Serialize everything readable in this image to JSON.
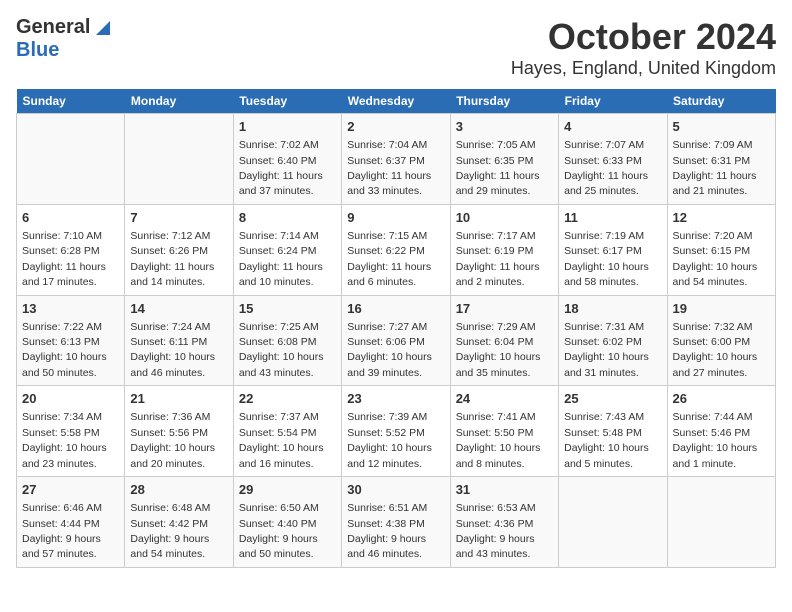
{
  "logo": {
    "line1": "General",
    "line2": "Blue"
  },
  "title": "October 2024",
  "subtitle": "Hayes, England, United Kingdom",
  "days_of_week": [
    "Sunday",
    "Monday",
    "Tuesday",
    "Wednesday",
    "Thursday",
    "Friday",
    "Saturday"
  ],
  "weeks": [
    [
      {
        "day": "",
        "sunrise": "",
        "sunset": "",
        "daylight": ""
      },
      {
        "day": "",
        "sunrise": "",
        "sunset": "",
        "daylight": ""
      },
      {
        "day": "1",
        "sunrise": "Sunrise: 7:02 AM",
        "sunset": "Sunset: 6:40 PM",
        "daylight": "Daylight: 11 hours and 37 minutes."
      },
      {
        "day": "2",
        "sunrise": "Sunrise: 7:04 AM",
        "sunset": "Sunset: 6:37 PM",
        "daylight": "Daylight: 11 hours and 33 minutes."
      },
      {
        "day": "3",
        "sunrise": "Sunrise: 7:05 AM",
        "sunset": "Sunset: 6:35 PM",
        "daylight": "Daylight: 11 hours and 29 minutes."
      },
      {
        "day": "4",
        "sunrise": "Sunrise: 7:07 AM",
        "sunset": "Sunset: 6:33 PM",
        "daylight": "Daylight: 11 hours and 25 minutes."
      },
      {
        "day": "5",
        "sunrise": "Sunrise: 7:09 AM",
        "sunset": "Sunset: 6:31 PM",
        "daylight": "Daylight: 11 hours and 21 minutes."
      }
    ],
    [
      {
        "day": "6",
        "sunrise": "Sunrise: 7:10 AM",
        "sunset": "Sunset: 6:28 PM",
        "daylight": "Daylight: 11 hours and 17 minutes."
      },
      {
        "day": "7",
        "sunrise": "Sunrise: 7:12 AM",
        "sunset": "Sunset: 6:26 PM",
        "daylight": "Daylight: 11 hours and 14 minutes."
      },
      {
        "day": "8",
        "sunrise": "Sunrise: 7:14 AM",
        "sunset": "Sunset: 6:24 PM",
        "daylight": "Daylight: 11 hours and 10 minutes."
      },
      {
        "day": "9",
        "sunrise": "Sunrise: 7:15 AM",
        "sunset": "Sunset: 6:22 PM",
        "daylight": "Daylight: 11 hours and 6 minutes."
      },
      {
        "day": "10",
        "sunrise": "Sunrise: 7:17 AM",
        "sunset": "Sunset: 6:19 PM",
        "daylight": "Daylight: 11 hours and 2 minutes."
      },
      {
        "day": "11",
        "sunrise": "Sunrise: 7:19 AM",
        "sunset": "Sunset: 6:17 PM",
        "daylight": "Daylight: 10 hours and 58 minutes."
      },
      {
        "day": "12",
        "sunrise": "Sunrise: 7:20 AM",
        "sunset": "Sunset: 6:15 PM",
        "daylight": "Daylight: 10 hours and 54 minutes."
      }
    ],
    [
      {
        "day": "13",
        "sunrise": "Sunrise: 7:22 AM",
        "sunset": "Sunset: 6:13 PM",
        "daylight": "Daylight: 10 hours and 50 minutes."
      },
      {
        "day": "14",
        "sunrise": "Sunrise: 7:24 AM",
        "sunset": "Sunset: 6:11 PM",
        "daylight": "Daylight: 10 hours and 46 minutes."
      },
      {
        "day": "15",
        "sunrise": "Sunrise: 7:25 AM",
        "sunset": "Sunset: 6:08 PM",
        "daylight": "Daylight: 10 hours and 43 minutes."
      },
      {
        "day": "16",
        "sunrise": "Sunrise: 7:27 AM",
        "sunset": "Sunset: 6:06 PM",
        "daylight": "Daylight: 10 hours and 39 minutes."
      },
      {
        "day": "17",
        "sunrise": "Sunrise: 7:29 AM",
        "sunset": "Sunset: 6:04 PM",
        "daylight": "Daylight: 10 hours and 35 minutes."
      },
      {
        "day": "18",
        "sunrise": "Sunrise: 7:31 AM",
        "sunset": "Sunset: 6:02 PM",
        "daylight": "Daylight: 10 hours and 31 minutes."
      },
      {
        "day": "19",
        "sunrise": "Sunrise: 7:32 AM",
        "sunset": "Sunset: 6:00 PM",
        "daylight": "Daylight: 10 hours and 27 minutes."
      }
    ],
    [
      {
        "day": "20",
        "sunrise": "Sunrise: 7:34 AM",
        "sunset": "Sunset: 5:58 PM",
        "daylight": "Daylight: 10 hours and 23 minutes."
      },
      {
        "day": "21",
        "sunrise": "Sunrise: 7:36 AM",
        "sunset": "Sunset: 5:56 PM",
        "daylight": "Daylight: 10 hours and 20 minutes."
      },
      {
        "day": "22",
        "sunrise": "Sunrise: 7:37 AM",
        "sunset": "Sunset: 5:54 PM",
        "daylight": "Daylight: 10 hours and 16 minutes."
      },
      {
        "day": "23",
        "sunrise": "Sunrise: 7:39 AM",
        "sunset": "Sunset: 5:52 PM",
        "daylight": "Daylight: 10 hours and 12 minutes."
      },
      {
        "day": "24",
        "sunrise": "Sunrise: 7:41 AM",
        "sunset": "Sunset: 5:50 PM",
        "daylight": "Daylight: 10 hours and 8 minutes."
      },
      {
        "day": "25",
        "sunrise": "Sunrise: 7:43 AM",
        "sunset": "Sunset: 5:48 PM",
        "daylight": "Daylight: 10 hours and 5 minutes."
      },
      {
        "day": "26",
        "sunrise": "Sunrise: 7:44 AM",
        "sunset": "Sunset: 5:46 PM",
        "daylight": "Daylight: 10 hours and 1 minute."
      }
    ],
    [
      {
        "day": "27",
        "sunrise": "Sunrise: 6:46 AM",
        "sunset": "Sunset: 4:44 PM",
        "daylight": "Daylight: 9 hours and 57 minutes."
      },
      {
        "day": "28",
        "sunrise": "Sunrise: 6:48 AM",
        "sunset": "Sunset: 4:42 PM",
        "daylight": "Daylight: 9 hours and 54 minutes."
      },
      {
        "day": "29",
        "sunrise": "Sunrise: 6:50 AM",
        "sunset": "Sunset: 4:40 PM",
        "daylight": "Daylight: 9 hours and 50 minutes."
      },
      {
        "day": "30",
        "sunrise": "Sunrise: 6:51 AM",
        "sunset": "Sunset: 4:38 PM",
        "daylight": "Daylight: 9 hours and 46 minutes."
      },
      {
        "day": "31",
        "sunrise": "Sunrise: 6:53 AM",
        "sunset": "Sunset: 4:36 PM",
        "daylight": "Daylight: 9 hours and 43 minutes."
      },
      {
        "day": "",
        "sunrise": "",
        "sunset": "",
        "daylight": ""
      },
      {
        "day": "",
        "sunrise": "",
        "sunset": "",
        "daylight": ""
      }
    ]
  ]
}
